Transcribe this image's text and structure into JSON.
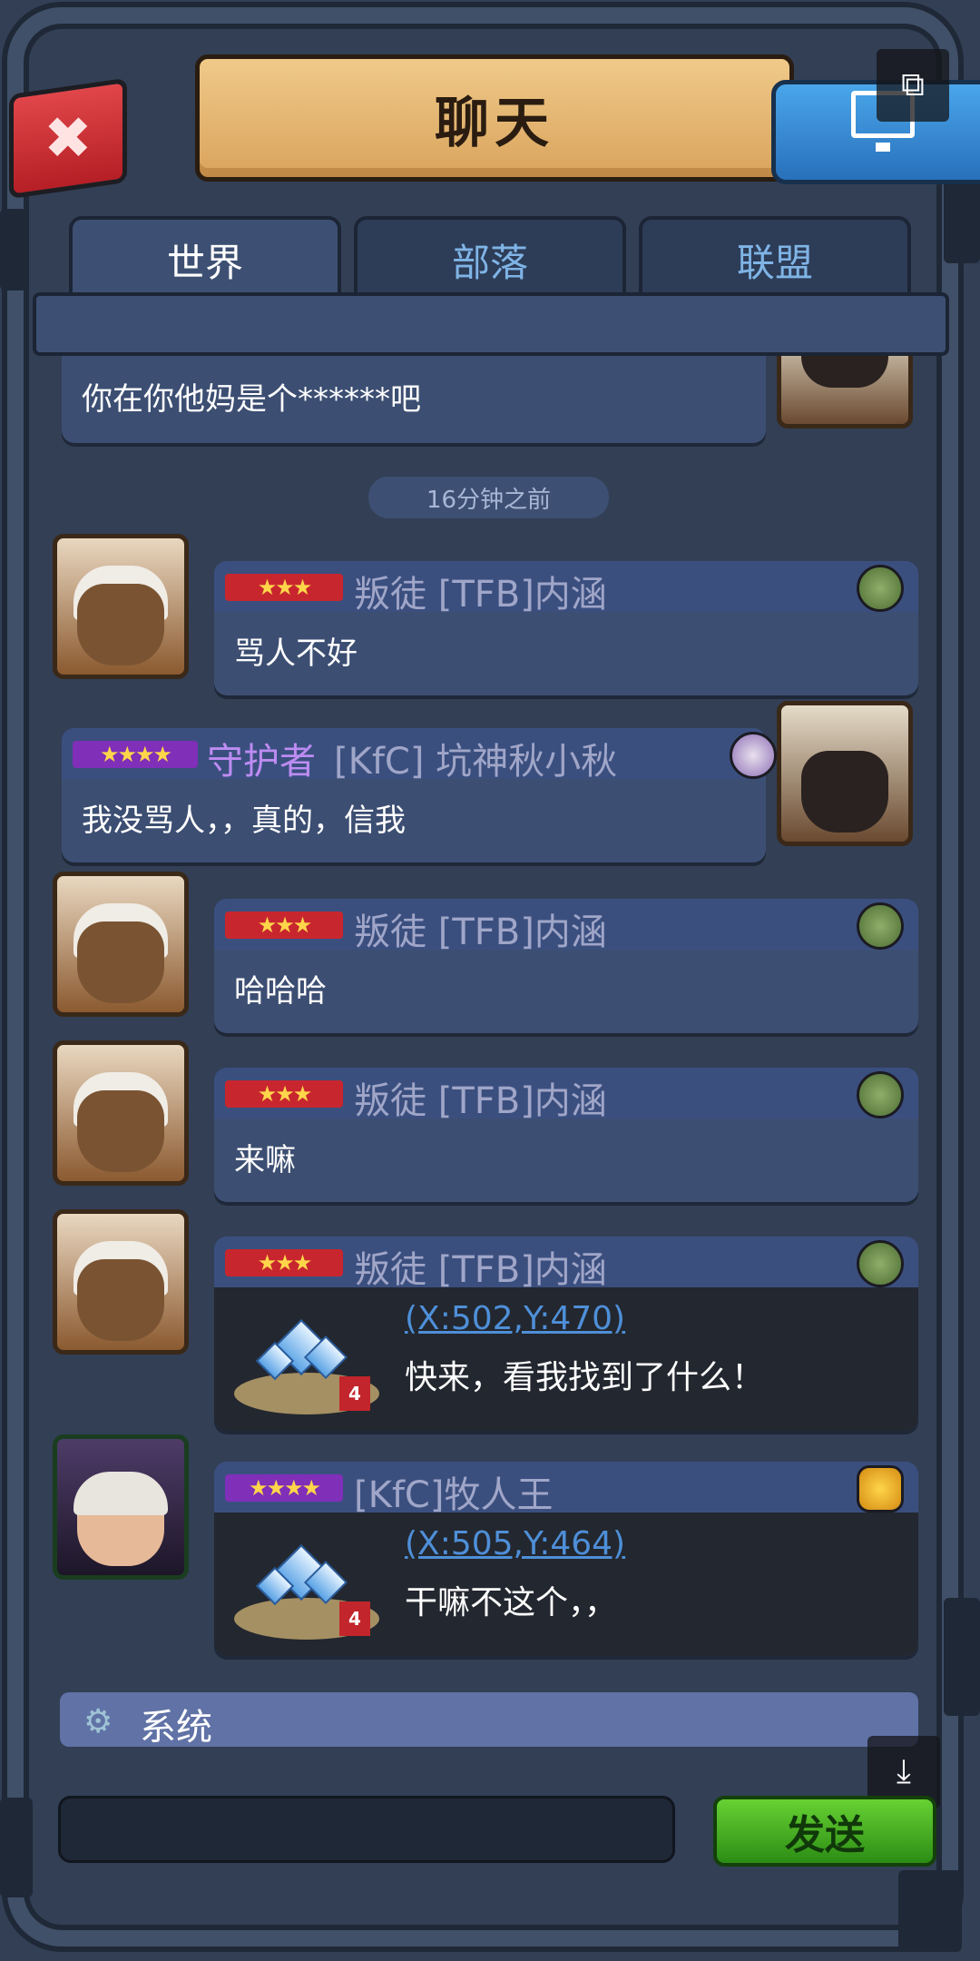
{
  "header": {
    "title": "聊天",
    "close_icon": "close-icon",
    "close_label": "✖"
  },
  "tabs": [
    {
      "label": "世界",
      "active": true
    },
    {
      "label": "部落",
      "active": false
    },
    {
      "label": "联盟",
      "active": false
    }
  ],
  "messages": {
    "partial": {
      "text": "你在你他妈是个******吧"
    },
    "timestamp": "16分钟之前",
    "m1": {
      "rank_stars": "★★★",
      "name": "叛徒 [TFB]内涵",
      "text": "骂人不好"
    },
    "m2": {
      "rank_stars": "★★★★",
      "title": "守护者",
      "name": "[KfC] 坑神秋小秋",
      "text": "我没骂人，，真的，信我"
    },
    "m3": {
      "rank_stars": "★★★",
      "name": "叛徒 [TFB]内涵",
      "text": "哈哈哈"
    },
    "m4": {
      "rank_stars": "★★★",
      "name": "叛徒 [TFB]内涵",
      "text": "来嘛"
    },
    "m5": {
      "rank_stars": "★★★",
      "name": "叛徒 [TFB]内涵",
      "coord": "(X:502,Y:470)",
      "text": "快来，看我找到了什么！",
      "level": "4"
    },
    "m6": {
      "rank_stars": "★★★★",
      "name": "[KfC]牧人王",
      "coord": "(X:505,Y:464)",
      "text": "干嘛不这个，，",
      "level": "4"
    }
  },
  "system": {
    "label": "系统",
    "icon": "gear-icon",
    "glyph": "⚙"
  },
  "input": {
    "value": "",
    "placeholder": ""
  },
  "send_label": "发送",
  "colors": {
    "accent_green": "#3aa51f",
    "name_purple": "#bd8cf2",
    "link_blue": "#4e8fd8"
  }
}
